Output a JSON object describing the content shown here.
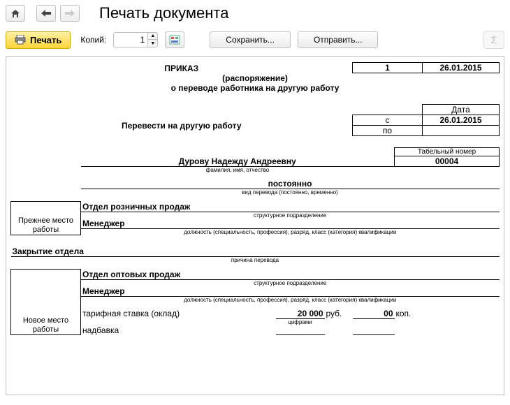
{
  "header": {
    "title": "Печать документа"
  },
  "actions": {
    "print": "Печать",
    "copies_label": "Копий:",
    "copies_value": "1",
    "save": "Сохранить...",
    "send": "Отправить..."
  },
  "doc": {
    "title1": "ПРИКАЗ",
    "title2": "(распоряжение)",
    "title3": "о переводе работника на другую работу",
    "number": "1",
    "date": "26.01.2015",
    "transfer_label": "Перевести на другую работу",
    "date_header": "Дата",
    "from_label": "с",
    "from_date": "26.01.2015",
    "to_label": "по",
    "to_date": "",
    "tab_num_label": "Табельный номер",
    "employee": "Дурову Надежду Андреевну",
    "employee_cap": "фамилия, имя, отчество",
    "tab_num": "00004",
    "duration": "постоянно",
    "duration_cap": "вид перевода (постоянно, временно)",
    "prev_label": "Прежнее место работы",
    "prev_dept": "Отдел розничных продаж",
    "struct_cap": "структурное подразделение",
    "prev_pos": "Менеджер",
    "pos_cap": "должность (специальность, профессия), разряд, класс (категория) квалификации",
    "reason": "Закрытие отдела",
    "reason_cap": "причина перевода",
    "new_label": "Новое место работы",
    "new_dept": "Отдел оптовых продаж",
    "new_pos": "Менеджер",
    "rate_label": "тарифная ставка (оклад)",
    "rate_rub": "20 000",
    "rub": "руб.",
    "rate_kop": "00",
    "kop": "коп.",
    "rate_cap": "цифрами",
    "addon": "надбавка"
  }
}
